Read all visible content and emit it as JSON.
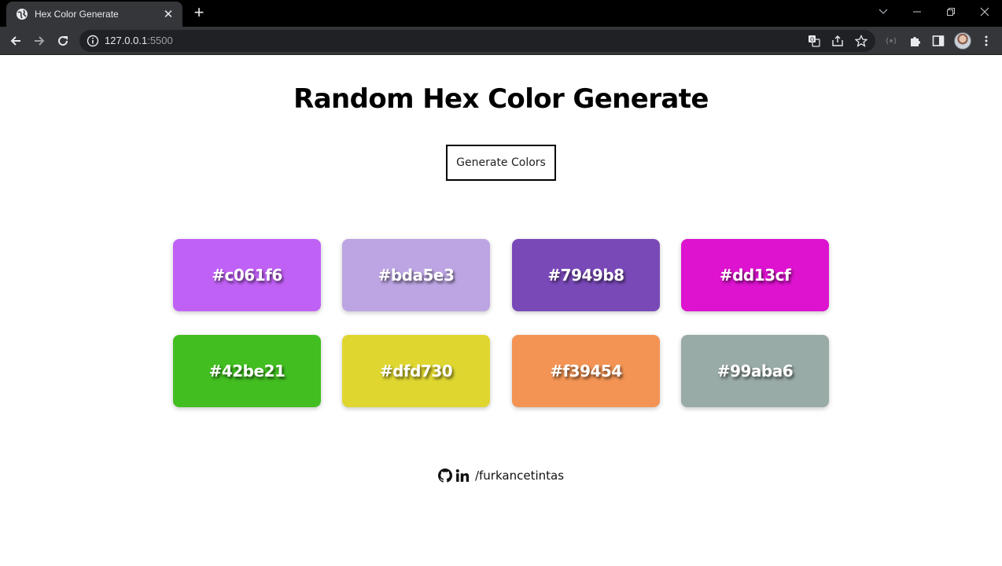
{
  "browser": {
    "tab": {
      "title": "Hex Color Generate",
      "close_glyph": "✕"
    },
    "new_tab_glyph": "+",
    "address": {
      "host": "127.0.0.1",
      "port": ":5500"
    },
    "icons": [
      "globe-icon",
      "back-icon",
      "forward-icon",
      "reload-icon",
      "info-icon",
      "translate-icon",
      "share-icon",
      "star-icon",
      "extensions-icon",
      "sidepanel-icon",
      "menu-icon",
      "minimize-icon",
      "restore-icon",
      "close-window-icon"
    ]
  },
  "page": {
    "title": "Random Hex Color Generate",
    "button_label": "Generate Colors",
    "colors": [
      {
        "label": "#c061f6",
        "hex": "#c061f6"
      },
      {
        "label": "#bda5e3",
        "hex": "#bda5e3"
      },
      {
        "label": "#7949b8",
        "hex": "#7949b8"
      },
      {
        "label": "#dd13cf",
        "hex": "#dd13cf"
      },
      {
        "label": "#42be21",
        "hex": "#42be21"
      },
      {
        "label": "#dfd730",
        "hex": "#dfd730"
      },
      {
        "label": "#f39454",
        "hex": "#f39454"
      },
      {
        "label": "#99aba6",
        "hex": "#99aba6"
      }
    ],
    "footer": {
      "handle": "/furkancetintas",
      "icons": [
        "github-icon",
        "linkedin-icon"
      ]
    }
  }
}
